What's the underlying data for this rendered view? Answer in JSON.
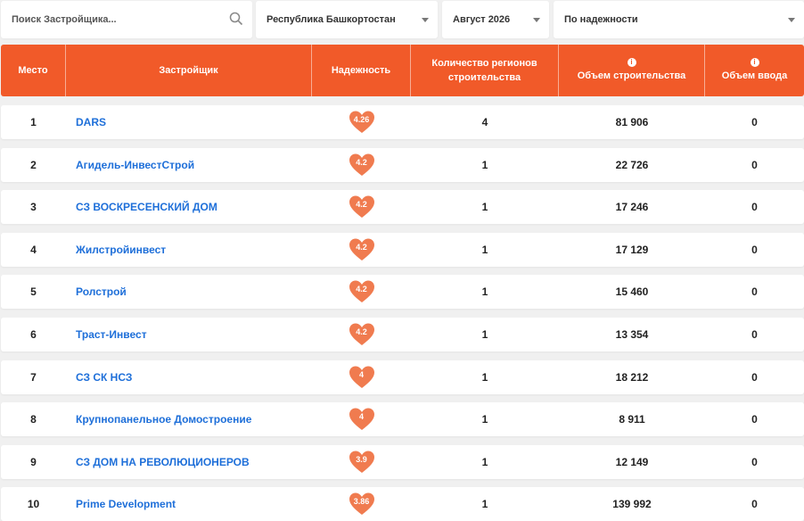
{
  "filters": {
    "search_placeholder": "Поиск Застройщика...",
    "region": "Республика Башкортостан",
    "period": "Август 2026",
    "sort": "По надежности"
  },
  "header": {
    "place": "Место",
    "developer": "Застройщик",
    "reliability": "Надежность",
    "regions_line1": "Количество регионов",
    "regions_line2": "строительства",
    "volume": "Объем строительства",
    "input": "Объем ввода",
    "info_glyph": "i"
  },
  "colors": {
    "accent": "#f15a29",
    "heart": "#f07b4f",
    "link": "#1e6fd9"
  },
  "rows": [
    {
      "place": "1",
      "name": "DARS",
      "rating": "4.26",
      "regions": "4",
      "volume": "81 906",
      "input": "0"
    },
    {
      "place": "2",
      "name": "Агидель-ИнвестСтрой",
      "rating": "4.2",
      "regions": "1",
      "volume": "22 726",
      "input": "0"
    },
    {
      "place": "3",
      "name": "СЗ ВОСКРЕСЕНСКИЙ ДОМ",
      "rating": "4.2",
      "regions": "1",
      "volume": "17 246",
      "input": "0"
    },
    {
      "place": "4",
      "name": "Жилстройинвест",
      "rating": "4.2",
      "regions": "1",
      "volume": "17 129",
      "input": "0"
    },
    {
      "place": "5",
      "name": "Ролстрой",
      "rating": "4.2",
      "regions": "1",
      "volume": "15 460",
      "input": "0"
    },
    {
      "place": "6",
      "name": "Траст-Инвест",
      "rating": "4.2",
      "regions": "1",
      "volume": "13 354",
      "input": "0"
    },
    {
      "place": "7",
      "name": "СЗ СК НСЗ",
      "rating": "4",
      "regions": "1",
      "volume": "18 212",
      "input": "0"
    },
    {
      "place": "8",
      "name": "Крупнопанельное Домостроение",
      "rating": "4",
      "regions": "1",
      "volume": "8 911",
      "input": "0"
    },
    {
      "place": "9",
      "name": "СЗ ДОМ НА РЕВОЛЮЦИОНЕРОВ",
      "rating": "3.9",
      "regions": "1",
      "volume": "12 149",
      "input": "0"
    },
    {
      "place": "10",
      "name": "Prime Development",
      "rating": "3.86",
      "regions": "1",
      "volume": "139 992",
      "input": "0"
    }
  ]
}
